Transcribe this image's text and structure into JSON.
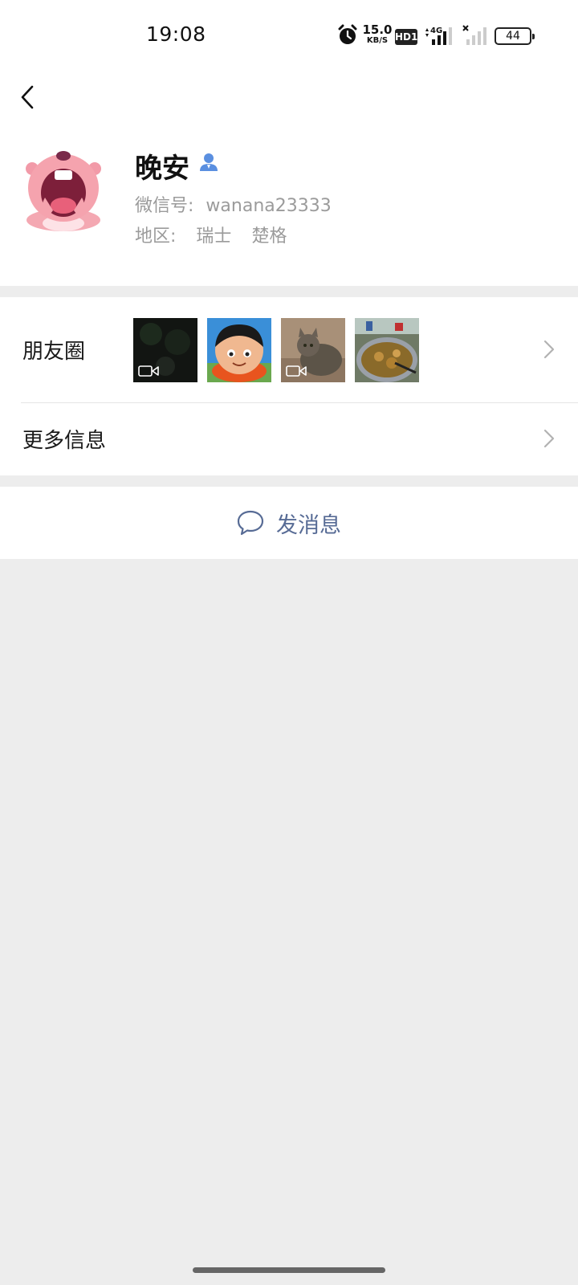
{
  "status_bar": {
    "time": "19:08",
    "net_speed_value": "15.0",
    "net_speed_unit": "KB/S",
    "hd_label": "HD1",
    "network_label": "4G",
    "battery_level": "44",
    "icons": [
      "alarm-icon",
      "hd-icon",
      "signal-4g-icon",
      "signal-no-service-icon",
      "battery-icon"
    ]
  },
  "profile": {
    "name": "晚安",
    "wechat_id_label": "微信号:",
    "wechat_id": "wanana23333",
    "region_label": "地区:",
    "region_country": "瑞士",
    "region_city": "楚格",
    "avatar_icon": "pink-beaver-avatar",
    "badge_icon": "friend-person-icon"
  },
  "moments": {
    "label": "朋友圈",
    "thumbnails": [
      {
        "name": "moment-thumb-dark-video",
        "is_video": true
      },
      {
        "name": "moment-thumb-cartoon-face",
        "is_video": false
      },
      {
        "name": "moment-thumb-cat-video",
        "is_video": true
      },
      {
        "name": "moment-thumb-food",
        "is_video": false
      }
    ]
  },
  "more_info": {
    "label": "更多信息"
  },
  "actions": {
    "send_message_label": "发消息"
  },
  "colors": {
    "link_blue": "#576b95",
    "background": "#ededed",
    "card": "#ffffff",
    "secondary_text": "#9b9b9b"
  }
}
